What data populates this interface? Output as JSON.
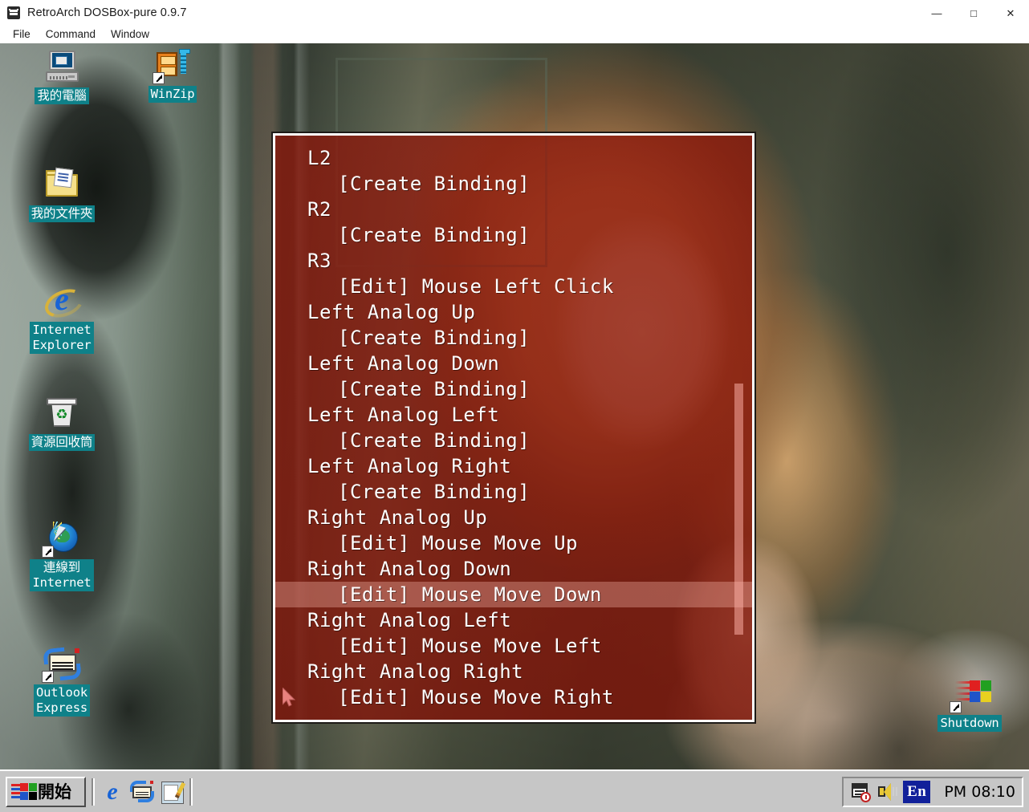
{
  "window": {
    "title": "RetroArch DOSBox-pure 0.9.7",
    "app_icon": "retroarch-icon",
    "controls": {
      "minimize": "—",
      "maximize": "□",
      "close": "✕"
    },
    "menu": [
      {
        "label": "File"
      },
      {
        "label": "Command"
      },
      {
        "label": "Window"
      }
    ]
  },
  "desktop": {
    "icons": [
      {
        "name": "my-computer",
        "label": "我的電腦",
        "shortcut": false
      },
      {
        "name": "winzip",
        "label": "WinZip",
        "shortcut": true
      },
      {
        "name": "my-documents",
        "label": "我的文件夾",
        "shortcut": false
      },
      {
        "name": "internet-explorer",
        "label": "Internet\nExplorer",
        "shortcut": false
      },
      {
        "name": "recycle-bin",
        "label": "資源回收筒",
        "shortcut": false
      },
      {
        "name": "connect-to-internet",
        "label": "連線到\nInternet",
        "shortcut": true
      },
      {
        "name": "outlook-express",
        "label": "Outlook\nExpress",
        "shortcut": true
      },
      {
        "name": "shutdown",
        "label": "Shutdown",
        "shortcut": true
      }
    ],
    "icon_label_bg": "#0f8189",
    "icon_label_color": "#ffffff"
  },
  "retroarch_menu": {
    "highlight_color": "#ffbeb4",
    "background_tint": "#961609",
    "border_color": "#ffffff",
    "rows": [
      {
        "kind": "label",
        "text": "L2",
        "selected": false
      },
      {
        "kind": "value",
        "text": "[Create Binding]",
        "selected": false
      },
      {
        "kind": "label",
        "text": "R2",
        "selected": false
      },
      {
        "kind": "value",
        "text": "[Create Binding]",
        "selected": false
      },
      {
        "kind": "label",
        "text": "R3",
        "selected": false
      },
      {
        "kind": "value",
        "text": "[Edit] Mouse Left Click",
        "selected": false
      },
      {
        "kind": "label",
        "text": "Left Analog Up",
        "selected": false
      },
      {
        "kind": "value",
        "text": "[Create Binding]",
        "selected": false
      },
      {
        "kind": "label",
        "text": "Left Analog Down",
        "selected": false
      },
      {
        "kind": "value",
        "text": "[Create Binding]",
        "selected": false
      },
      {
        "kind": "label",
        "text": "Left Analog Left",
        "selected": false
      },
      {
        "kind": "value",
        "text": "[Create Binding]",
        "selected": false
      },
      {
        "kind": "label",
        "text": "Left Analog Right",
        "selected": false
      },
      {
        "kind": "value",
        "text": "[Create Binding]",
        "selected": false
      },
      {
        "kind": "label",
        "text": "Right Analog Up",
        "selected": false
      },
      {
        "kind": "value",
        "text": "[Edit] Mouse Move Up",
        "selected": false
      },
      {
        "kind": "label",
        "text": "Right Analog Down",
        "selected": false
      },
      {
        "kind": "value",
        "text": "[Edit] Mouse Move Down",
        "selected": true
      },
      {
        "kind": "label",
        "text": "Right Analog Left",
        "selected": false
      },
      {
        "kind": "value",
        "text": "[Edit] Mouse Move Left",
        "selected": false
      },
      {
        "kind": "label",
        "text": "Right Analog Right",
        "selected": false
      },
      {
        "kind": "value",
        "text": "[Edit] Mouse Move Right",
        "selected": false
      }
    ]
  },
  "taskbar": {
    "start_label": "開始",
    "quick_launch": [
      {
        "name": "internet-explorer"
      },
      {
        "name": "outlook-express"
      },
      {
        "name": "paint"
      }
    ],
    "tray": {
      "language": "En",
      "clock": "PM 08:10"
    }
  }
}
